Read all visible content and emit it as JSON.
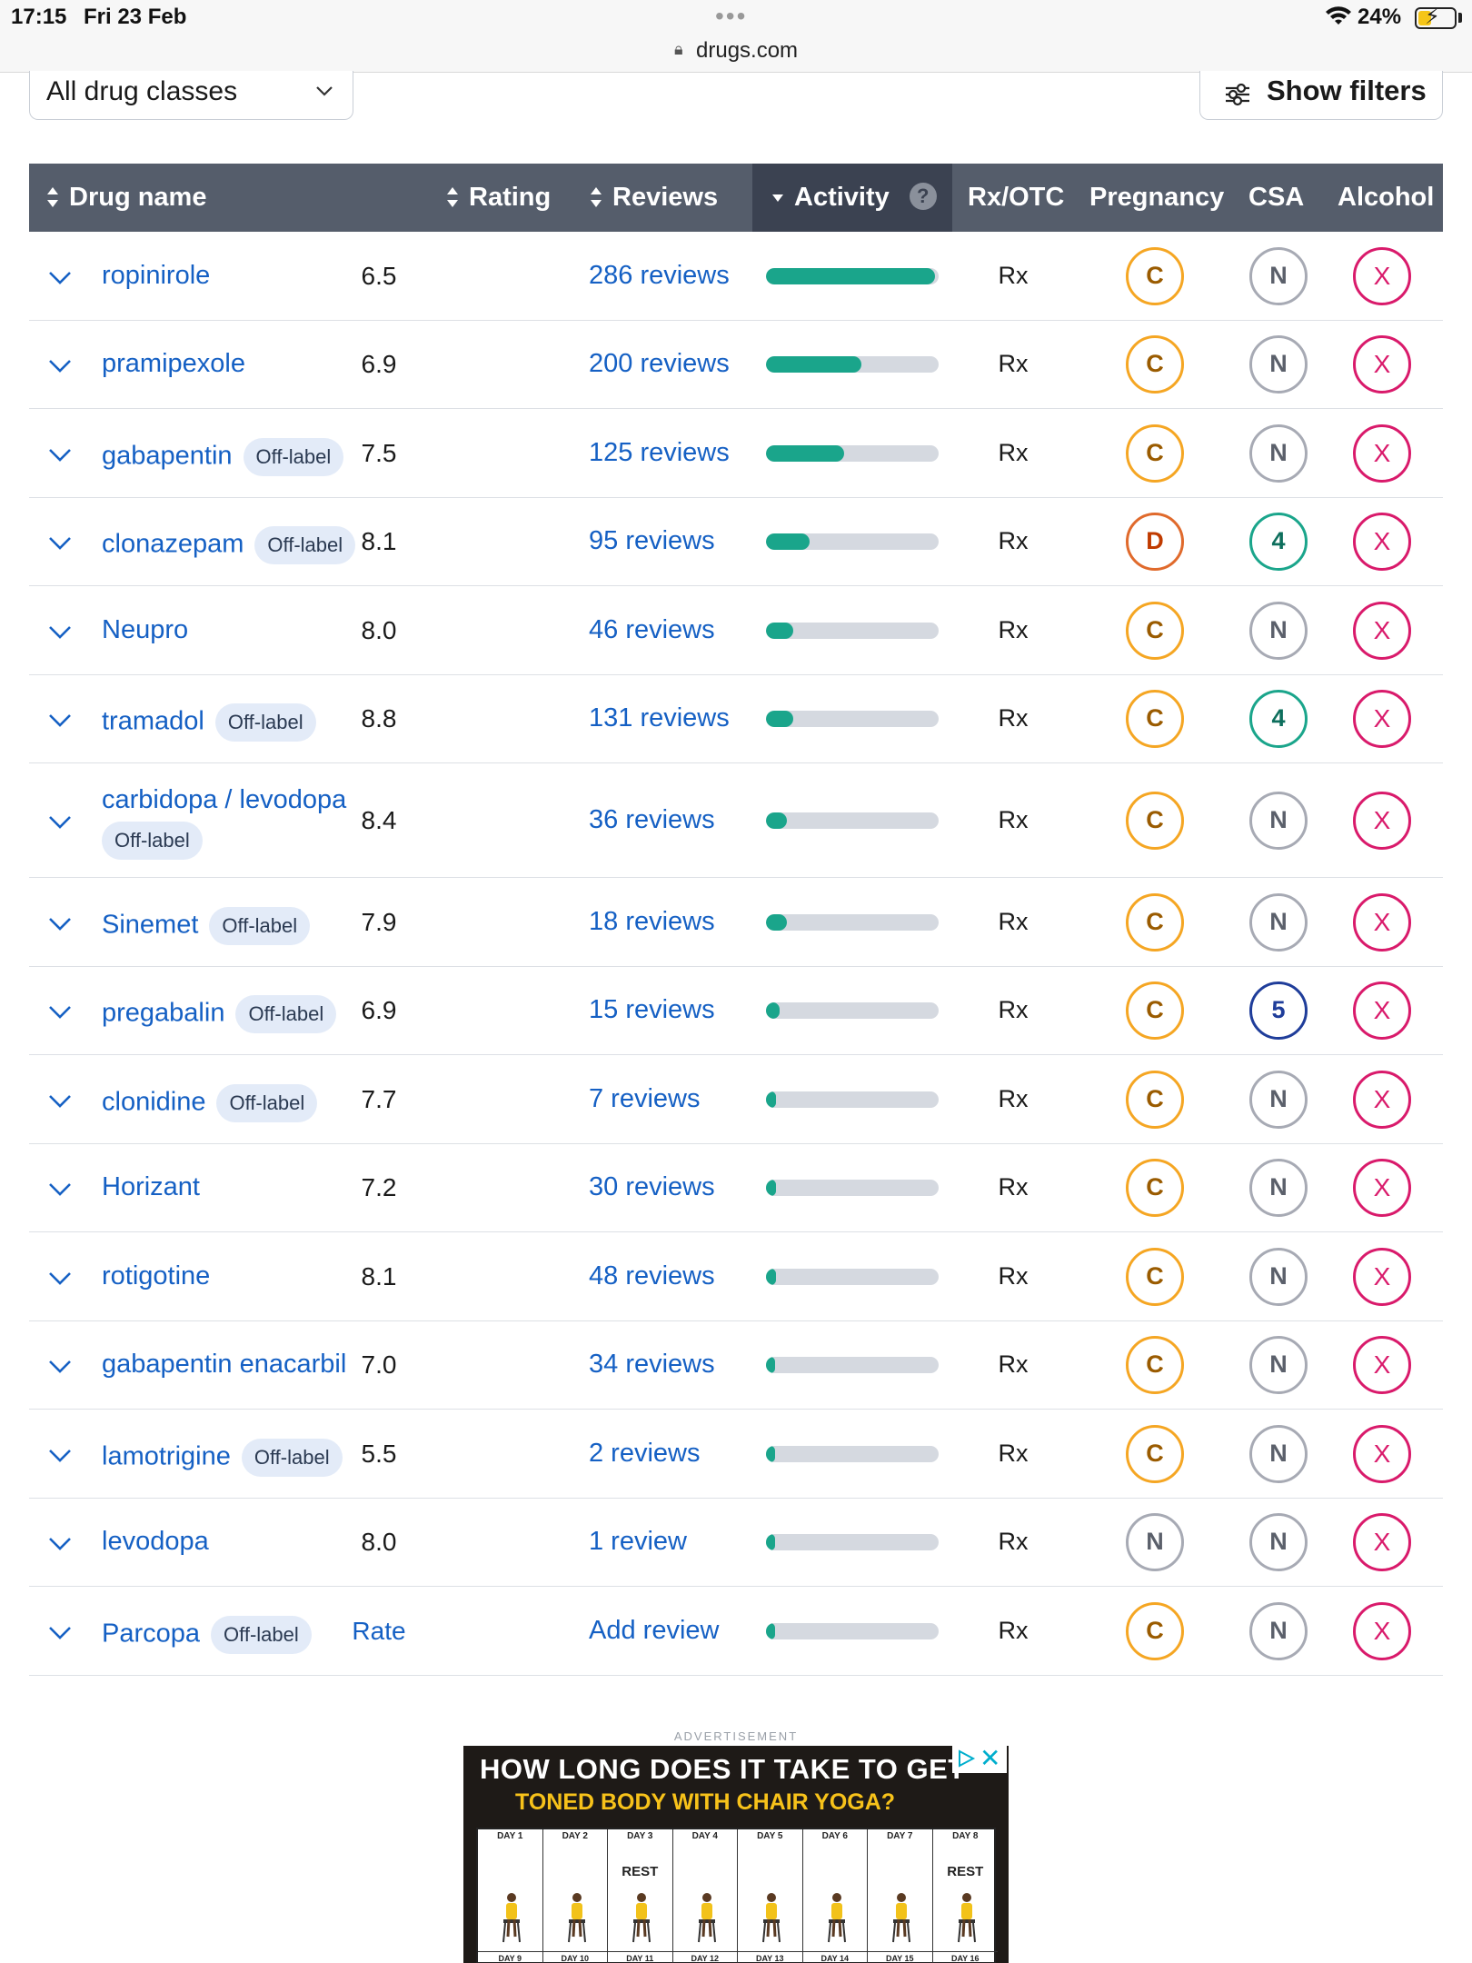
{
  "status_bar": {
    "time": "17:15",
    "date": "Fri 23 Feb",
    "battery": "24%"
  },
  "browser": {
    "url": "drugs.com"
  },
  "controls": {
    "class_select": "All drug classes",
    "filters_button": "Show filters"
  },
  "table": {
    "headers": {
      "drug_name": "Drug name",
      "rating": "Rating",
      "reviews": "Reviews",
      "activity": "Activity",
      "activity_help": "?",
      "rx_otc": "Rx/OTC",
      "pregnancy": "Pregnancy",
      "csa": "CSA",
      "alcohol": "Alcohol"
    },
    "rows": [
      {
        "name": "ropinirole",
        "badge": "",
        "rating": "6.5",
        "reviews": "286 reviews",
        "activity": 0.98,
        "rx": "Rx",
        "pregnancy": "C",
        "csa": "N",
        "alcohol": "X"
      },
      {
        "name": "pramipexole",
        "badge": "",
        "rating": "6.9",
        "reviews": "200 reviews",
        "activity": 0.55,
        "rx": "Rx",
        "pregnancy": "C",
        "csa": "N",
        "alcohol": "X"
      },
      {
        "name": "gabapentin",
        "badge": "Off-label",
        "rating": "7.5",
        "reviews": "125 reviews",
        "activity": 0.45,
        "rx": "Rx",
        "pregnancy": "C",
        "csa": "N",
        "alcohol": "X"
      },
      {
        "name": "clonazepam",
        "badge": "Off-label",
        "rating": "8.1",
        "reviews": "95 reviews",
        "activity": 0.25,
        "rx": "Rx",
        "pregnancy": "D",
        "csa": "4",
        "alcohol": "X"
      },
      {
        "name": "Neupro",
        "badge": "",
        "rating": "8.0",
        "reviews": "46 reviews",
        "activity": 0.16,
        "rx": "Rx",
        "pregnancy": "C",
        "csa": "N",
        "alcohol": "X"
      },
      {
        "name": "tramadol",
        "badge": "Off-label",
        "rating": "8.8",
        "reviews": "131 reviews",
        "activity": 0.16,
        "rx": "Rx",
        "pregnancy": "C",
        "csa": "4",
        "alcohol": "X"
      },
      {
        "name": "carbidopa / levodopa",
        "badge": "Off-label",
        "badge_below": true,
        "rating": "8.4",
        "reviews": "36 reviews",
        "activity": 0.12,
        "rx": "Rx",
        "pregnancy": "C",
        "csa": "N",
        "alcohol": "X"
      },
      {
        "name": "Sinemet",
        "badge": "Off-label",
        "rating": "7.9",
        "reviews": "18 reviews",
        "activity": 0.12,
        "rx": "Rx",
        "pregnancy": "C",
        "csa": "N",
        "alcohol": "X"
      },
      {
        "name": "pregabalin",
        "badge": "Off-label",
        "rating": "6.9",
        "reviews": "15 reviews",
        "activity": 0.08,
        "rx": "Rx",
        "pregnancy": "C",
        "csa": "5",
        "alcohol": "X"
      },
      {
        "name": "clonidine",
        "badge": "Off-label",
        "rating": "7.7",
        "reviews": "7 reviews",
        "activity": 0.06,
        "rx": "Rx",
        "pregnancy": "C",
        "csa": "N",
        "alcohol": "X"
      },
      {
        "name": "Horizant",
        "badge": "",
        "rating": "7.2",
        "reviews": "30 reviews",
        "activity": 0.06,
        "rx": "Rx",
        "pregnancy": "C",
        "csa": "N",
        "alcohol": "X"
      },
      {
        "name": "rotigotine",
        "badge": "",
        "rating": "8.1",
        "reviews": "48 reviews",
        "activity": 0.06,
        "rx": "Rx",
        "pregnancy": "C",
        "csa": "N",
        "alcohol": "X"
      },
      {
        "name": "gabapentin enacarbil",
        "badge": "",
        "rating": "7.0",
        "reviews": "34 reviews",
        "activity": 0.05,
        "rx": "Rx",
        "pregnancy": "C",
        "csa": "N",
        "alcohol": "X"
      },
      {
        "name": "lamotrigine",
        "badge": "Off-label",
        "rating": "5.5",
        "reviews": "2 reviews",
        "activity": 0.04,
        "rx": "Rx",
        "pregnancy": "C",
        "csa": "N",
        "alcohol": "X"
      },
      {
        "name": "levodopa",
        "badge": "",
        "rating": "8.0",
        "reviews": "1 review",
        "activity": 0.03,
        "rx": "Rx",
        "pregnancy": "N",
        "csa": "N",
        "alcohol": "X"
      },
      {
        "name": "Parcopa",
        "badge": "Off-label",
        "rating": "Rate",
        "rating_link": true,
        "reviews": "Add review",
        "activity": 0.02,
        "rx": "Rx",
        "pregnancy": "C",
        "csa": "N",
        "alcohol": "X"
      }
    ]
  },
  "advertisement": {
    "label": "ADVERTISEMENT",
    "title": "HOW LONG DOES IT TAKE TO GET",
    "subtitle": "TONED BODY WITH CHAIR YOGA?",
    "days": [
      "DAY 1",
      "DAY 2",
      "DAY 3",
      "DAY 4",
      "DAY 5",
      "DAY 6",
      "DAY 7",
      "DAY 8"
    ],
    "rest_label": "REST",
    "rest_days": [
      2,
      7
    ],
    "footer_days": [
      "DAY 9",
      "DAY 10",
      "DAY 11",
      "DAY 12",
      "DAY 13",
      "DAY 14",
      "DAY 15",
      "DAY 16"
    ]
  },
  "colors": {
    "link": "#1560c4",
    "header_bg": "#555d6b",
    "activity_fill": "#1aa58b",
    "pregnancy_c": "#f5a623",
    "pregnancy_d": "#e06a2c",
    "csa_schedule_4": "#1aa58b",
    "csa_schedule_5": "#1f3d9a",
    "alcohol_x": "#d91a6b"
  }
}
